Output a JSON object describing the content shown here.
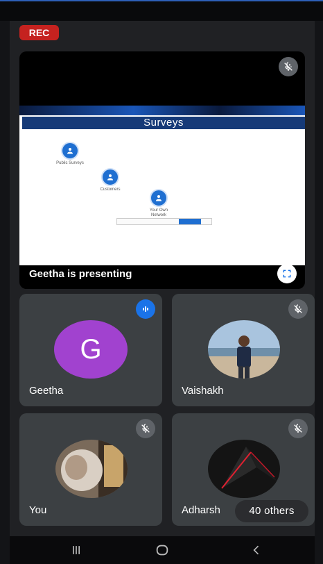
{
  "recording": {
    "label": "REC"
  },
  "presentation": {
    "presenting_label": "Geetha is presenting",
    "slide": {
      "title": "Surveys",
      "nodes": [
        {
          "label": "Public Surveys"
        },
        {
          "label": "Customers"
        },
        {
          "label": "Your Own Network"
        }
      ]
    }
  },
  "participants": [
    {
      "name": "Geetha",
      "avatar_letter": "G",
      "avatar_color": "#a142cf",
      "status": "speaking"
    },
    {
      "name": "Vaishakh",
      "status": "muted"
    },
    {
      "name": "You",
      "status": "muted"
    },
    {
      "name": "Adharsh",
      "status": "muted"
    }
  ],
  "others": {
    "label": "40 others"
  },
  "colors": {
    "rec": "#c5221f",
    "speaking": "#1a73e8",
    "tile": "#3c4043",
    "background": "#202124"
  },
  "icons": {
    "mute": "mic-off-icon",
    "speaking": "audio-level-icon",
    "fullscreen": "fullscreen-icon"
  }
}
